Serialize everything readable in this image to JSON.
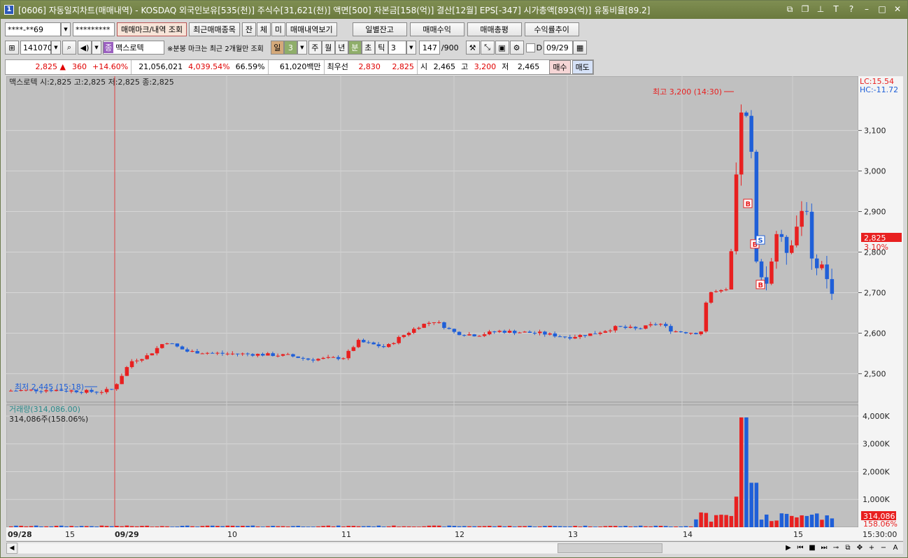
{
  "window": {
    "badge": "1",
    "title": "[0606] 자동일지차트(매매내역) - KOSDAQ 외국인보유[535(천)] 주식수[31,621(천)] 액면[500] 자본금[158(억)] 결산[12월] EPS[-347] 시가총액[893(억)] 유통비율[89.2]"
  },
  "toolbar1": {
    "account": "****-**69",
    "password": "*********",
    "btn_mark": "매매마크/내역 조회",
    "btn_recent": "최근매매종목",
    "t1": "잔",
    "t2": "체",
    "t3": "미",
    "btn_history": "매매내역보기",
    "btn_daily": "일별잔고",
    "btn_profit": "매매수익",
    "btn_total": "매매총평",
    "btn_rate": "수익률추이"
  },
  "toolbar2": {
    "code": "141070",
    "name_badge": "종",
    "name": "맥스로텍",
    "note": "※분봉 마크는 최근 2개월만 조회",
    "period_day": "일",
    "period_num": "3",
    "week": "주",
    "month": "월",
    "year": "년",
    "minute": "분",
    "second": "초",
    "tick": "틱",
    "tick_num": "3",
    "count": "147",
    "count_max": "/900",
    "d_label": "D",
    "date": "09/29"
  },
  "quote": {
    "price": "2,825",
    "arrow": "▲",
    "change": "360",
    "change_pct": "+14.60%",
    "volume": "21,056,021",
    "vol_pct": "4,039.54%",
    "turnover": "66.59%",
    "amount": "61,020백만",
    "best_label": "최우선",
    "best_ask": "2,830",
    "best_bid": "2,825",
    "open_label": "시",
    "open": "2,465",
    "high_label": "고",
    "high": "3,200",
    "low_label": "저",
    "low": "2,465",
    "buy": "매수",
    "sell": "매도"
  },
  "chart_data": {
    "type": "candlestick",
    "header": "맥스로텍 시:2,825 고:2,825 저:2,825 종:2,825",
    "lc": "LC:15.54",
    "hc": "HC:-11.72",
    "y_ticks": [
      "3,100",
      "3,000",
      "2,900",
      "2,800",
      "2,700",
      "2,600",
      "2,500"
    ],
    "y_values": [
      3100,
      3000,
      2900,
      2800,
      2700,
      2600,
      2500
    ],
    "ylim": [
      2430,
      3220
    ],
    "high_note": "최고 3,200 (14:30)",
    "low_note": "최저 2,445 (15:18)",
    "last_price": "2,825",
    "last_pct": "3.10%",
    "x_labels": [
      "09/28",
      "15",
      "09/29",
      "10",
      "11",
      "12",
      "13",
      "14",
      "15",
      "15:30:00"
    ],
    "volume_title": "거래량(314,086.00)",
    "volume_sub": "314,086주(158.06%)",
    "vol_ticks": [
      "4,000K",
      "3,000K",
      "2,000K",
      "1,000K"
    ],
    "vol_values": [
      4000,
      3000,
      2000,
      1000
    ],
    "vol_last": "314,086",
    "vol_last_pct": "158.06%",
    "trade_marks": [
      {
        "t": "B"
      },
      {
        "t": "B"
      },
      {
        "t": "S"
      },
      {
        "t": "B"
      }
    ]
  }
}
